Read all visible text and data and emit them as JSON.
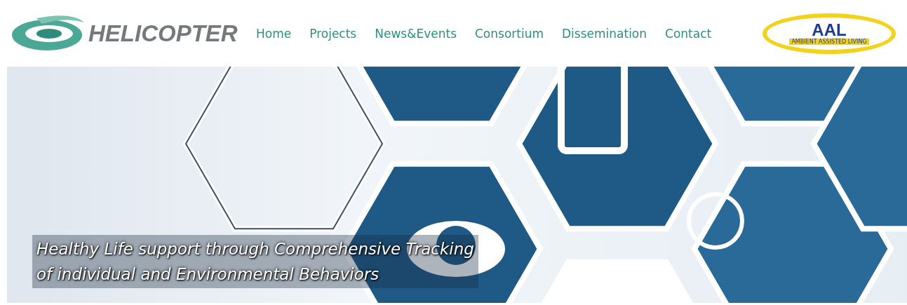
{
  "header": {
    "logo_text": "HELICOPTER",
    "nav": [
      {
        "label": "Home"
      },
      {
        "label": "Projects"
      },
      {
        "label": "News&Events"
      },
      {
        "label": "Consortium"
      },
      {
        "label": "Dissemination"
      },
      {
        "label": "Contact"
      }
    ],
    "partner_logo": {
      "text": "AAL",
      "subtitle": "AMBIENT ASSISTED LIVING"
    }
  },
  "hero": {
    "caption_lines": [
      "Healthy Life support through Comprehensive Tracking",
      "of individual and Environmental Behaviors"
    ]
  }
}
